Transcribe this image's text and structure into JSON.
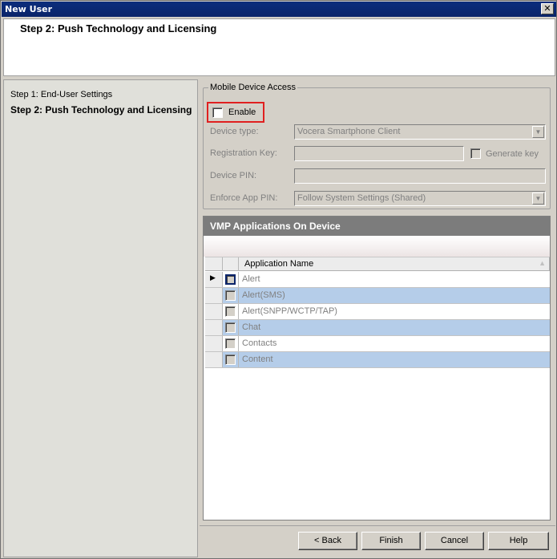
{
  "window": {
    "title": "New User",
    "close_glyph": "✕"
  },
  "header": {
    "step_title": "Step 2: Push Technology and Licensing"
  },
  "steps": [
    {
      "label": "Step 1: End-User Settings"
    },
    {
      "label": "Step 2: Push Technology and Licensing"
    }
  ],
  "mobile_access": {
    "legend": "Mobile Device Access",
    "enable_label": "Enable",
    "device_type_label": "Device type:",
    "device_type_value": "Vocera Smartphone Client",
    "registration_key_label": "Registration Key:",
    "registration_key_value": "",
    "generate_key_label": "Generate  key",
    "device_pin_label": "Device PIN:",
    "device_pin_value": "",
    "enforce_pin_label": "Enforce App PIN:",
    "enforce_pin_value": "Follow System Settings (Shared)"
  },
  "grid": {
    "caption": "VMP Applications On Device",
    "column_name": "Application Name",
    "sort_glyph": "▲",
    "current_row_glyph": "▶",
    "rows": [
      {
        "name": "Alert"
      },
      {
        "name": "Alert(SMS)"
      },
      {
        "name": "Alert(SNPP/WCTP/TAP)"
      },
      {
        "name": "Chat"
      },
      {
        "name": "Contacts"
      },
      {
        "name": "Content"
      }
    ]
  },
  "footer": {
    "back": "< Back",
    "finish": "Finish",
    "cancel": "Cancel",
    "help": "Help"
  }
}
